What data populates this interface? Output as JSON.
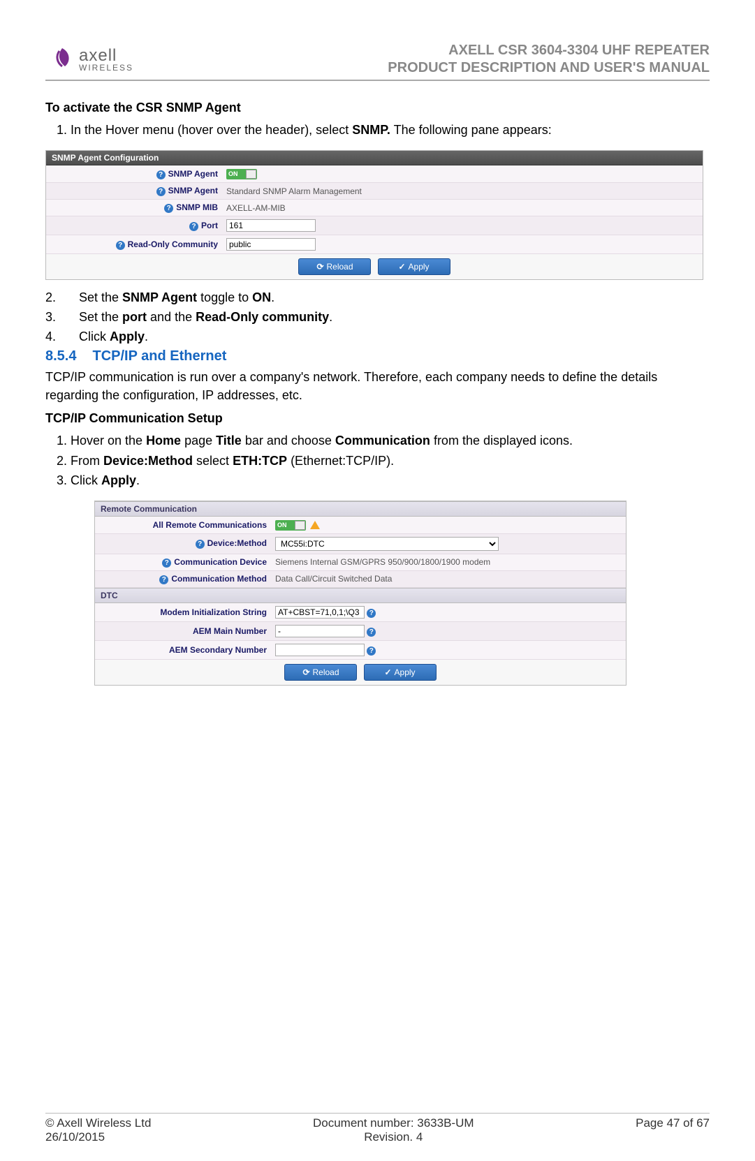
{
  "header": {
    "logo_name": "axell",
    "logo_sub": "WIRELESS",
    "title_line1": "AXELL CSR 3604-3304 UHF REPEATER",
    "title_line2": "PRODUCT DESCRIPTION AND USER'S MANUAL"
  },
  "sect1": {
    "title": "To activate the CSR SNMP Agent",
    "step1_pre": "In the Hover menu (hover over the header), select ",
    "step1_bold": "SNMP.",
    "step1_post": " The following pane appears:",
    "step2_num": "2.",
    "step2_a": "Set the ",
    "step2_b": "SNMP Agent",
    "step2_c": " toggle to ",
    "step2_d": "ON",
    "step2_e": ".",
    "step3_num": "3.",
    "step3_a": "Set the ",
    "step3_b": "port",
    "step3_c": " and the ",
    "step3_d": "Read-Only community",
    "step3_e": ".",
    "step4_num": "4.",
    "step4_a": "Click ",
    "step4_b": "Apply",
    "step4_c": "."
  },
  "panel1": {
    "title": "SNMP Agent Configuration",
    "rows": [
      {
        "label": "SNMP Agent",
        "type": "toggle",
        "value": "ON"
      },
      {
        "label": "SNMP Agent",
        "type": "text",
        "value": "Standard SNMP Alarm Management"
      },
      {
        "label": "SNMP MIB",
        "type": "text",
        "value": "AXELL-AM-MIB"
      },
      {
        "label": "Port",
        "type": "input",
        "value": "161"
      },
      {
        "label": "Read-Only Community",
        "type": "input",
        "value": "public"
      }
    ],
    "reload": "Reload",
    "apply": "Apply"
  },
  "sect2": {
    "num": "8.5.4",
    "title": "TCP/IP and Ethernet",
    "para": "TCP/IP communication is run over a company's network. Therefore, each company needs to define the details regarding the configuration, IP addresses, etc.",
    "subtitle": "TCP/IP Communication Setup",
    "s1_a": "Hover on the ",
    "s1_b": "Home",
    "s1_c": " page ",
    "s1_d": "Title",
    "s1_e": " bar and choose ",
    "s1_f": "Communication",
    "s1_g": " from the displayed icons.",
    "s2_a": "From ",
    "s2_b": "Device:Method",
    "s2_c": " select ",
    "s2_d": "ETH:TCP",
    "s2_e": " (Ethernet:TCP/IP).",
    "s3_a": "Click ",
    "s3_b": "Apply",
    "s3_c": "."
  },
  "panel2": {
    "title1": "Remote Communication",
    "rows1": [
      {
        "label": "All Remote Communications",
        "type": "toggle_warn",
        "value": "ON"
      },
      {
        "label": "Device:Method",
        "type": "select",
        "value": "MC55i:DTC"
      },
      {
        "label": "Communication Device",
        "type": "text",
        "value": "Siemens Internal GSM/GPRS 950/900/1800/1900 modem"
      },
      {
        "label": "Communication Method",
        "type": "text",
        "value": "Data Call/Circuit Switched Data"
      }
    ],
    "title2": "DTC",
    "rows2": [
      {
        "label": "Modem Initialization String",
        "type": "input_help",
        "value": "AT+CBST=71,0,1;\\Q3"
      },
      {
        "label": "AEM Main Number",
        "type": "input_help",
        "value": "-"
      },
      {
        "label": "AEM Secondary Number",
        "type": "input_help",
        "value": ""
      }
    ],
    "reload": "Reload",
    "apply": "Apply"
  },
  "footer": {
    "left1": "© Axell Wireless Ltd",
    "left2": "26/10/2015",
    "mid1": "Document number: 3633B-UM",
    "mid2": "Revision. 4",
    "right": "Page 47 of 67"
  }
}
